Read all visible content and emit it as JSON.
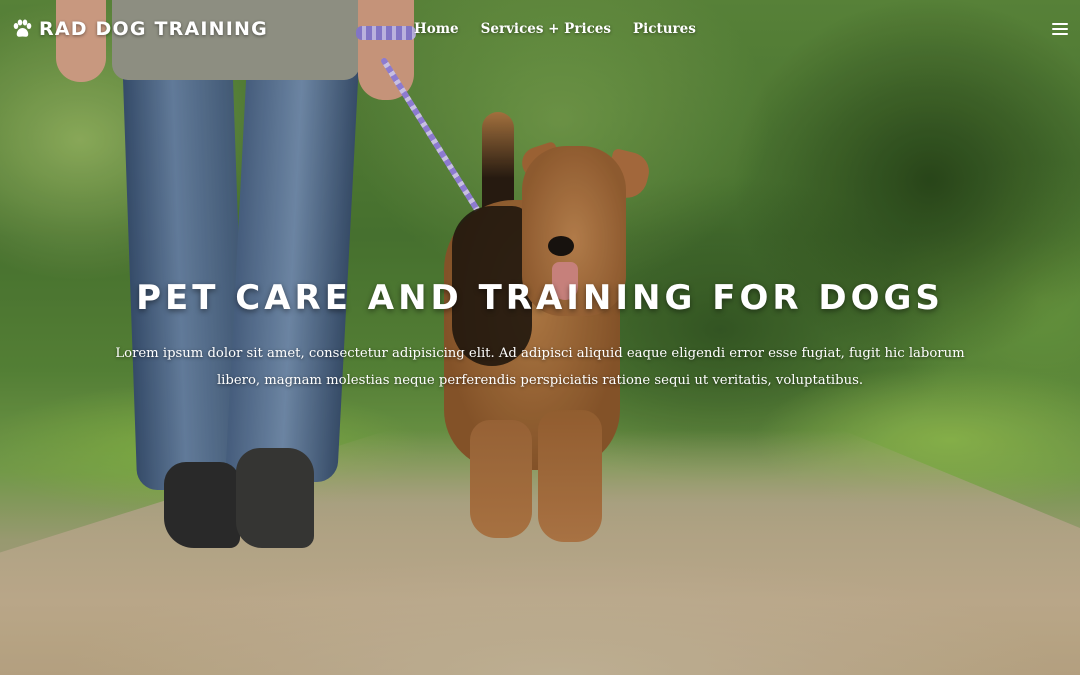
{
  "brand": {
    "name": "Rad Dog Training",
    "icon": "paw-icon"
  },
  "nav": {
    "links": [
      {
        "label": "Home"
      },
      {
        "label": "Services + Prices"
      },
      {
        "label": "Pictures"
      }
    ],
    "menu_icon": "hamburger-menu-icon"
  },
  "hero": {
    "title": "Pet Care and Training for Dogs",
    "text": "Lorem ipsum dolor sit amet, consectetur adipisicing elit. Ad adipisci aliquid eaque eligendi error esse fugiat, fugit hic laborum libero, magnam molestias neque perferendis perspiciatis ratione sequi ut veritatis, voluptatibus."
  },
  "colors": {
    "text": "#ffffff",
    "foliage": "#4d7a33",
    "path": "#c9b594",
    "leash": "#9a86e2"
  }
}
